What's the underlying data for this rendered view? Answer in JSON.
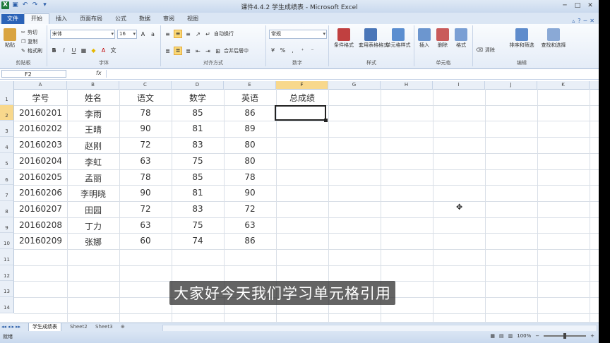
{
  "window": {
    "title": "课件4.4.2 学生成绩表 - Microsoft Excel",
    "controls": {
      "minimize": "─",
      "maximize": "□",
      "close": "✕"
    }
  },
  "tabs": [
    "文件",
    "开始",
    "插入",
    "页面布局",
    "公式",
    "数据",
    "审阅",
    "视图"
  ],
  "ribbon": {
    "clipboard": {
      "paste": "粘贴",
      "cut": "剪切",
      "copy": "复制",
      "format_painter": "格式刷",
      "label": "剪贴板"
    },
    "font": {
      "name": "宋体",
      "size": "16",
      "label": "字体"
    },
    "alignment": {
      "wrap": "自动换行",
      "merge": "合并后居中",
      "label": "对齐方式"
    },
    "number": {
      "format": "常规",
      "label": "数字"
    },
    "styles": {
      "conditional": "条件格式",
      "table": "套用表格格式",
      "cell": "单元格样式",
      "label": "样式"
    },
    "cells": {
      "insert": "插入",
      "delete": "删除",
      "format": "格式",
      "label": "单元格"
    },
    "editing": {
      "clear": "清除",
      "sort": "排序和筛选",
      "find": "查找和选择",
      "label": "编辑"
    }
  },
  "formula_bar": {
    "name_box": "F2",
    "fx": "fx",
    "value": ""
  },
  "columns": [
    "A",
    "B",
    "C",
    "D",
    "E",
    "F",
    "G",
    "H",
    "I",
    "J",
    "K"
  ],
  "active_column": "F",
  "rows": [
    "1",
    "2",
    "3",
    "4",
    "5",
    "6",
    "7",
    "8",
    "9",
    "10",
    "11",
    "12",
    "13",
    "14"
  ],
  "active_row": "2",
  "headers": [
    "学号",
    "姓名",
    "语文",
    "数学",
    "英语",
    "总成绩"
  ],
  "data": [
    [
      "20160201",
      "李雨",
      "78",
      "85",
      "86"
    ],
    [
      "20160202",
      "王晴",
      "90",
      "81",
      "89"
    ],
    [
      "20160203",
      "赵刚",
      "72",
      "83",
      "80"
    ],
    [
      "20160204",
      "李虹",
      "63",
      "75",
      "80"
    ],
    [
      "20160205",
      "孟丽",
      "78",
      "85",
      "78"
    ],
    [
      "20160206",
      "李明晓",
      "90",
      "81",
      "90"
    ],
    [
      "20160207",
      "田园",
      "72",
      "83",
      "72"
    ],
    [
      "20160208",
      "丁力",
      "63",
      "75",
      "63"
    ],
    [
      "20160209",
      "张娜",
      "60",
      "74",
      "86"
    ]
  ],
  "sheets": [
    "学生成绩表",
    "Sheet2",
    "Sheet3"
  ],
  "status": {
    "mode": "就绪",
    "zoom": "100%"
  },
  "subtitle": "大家好今天我们学习单元格引用"
}
